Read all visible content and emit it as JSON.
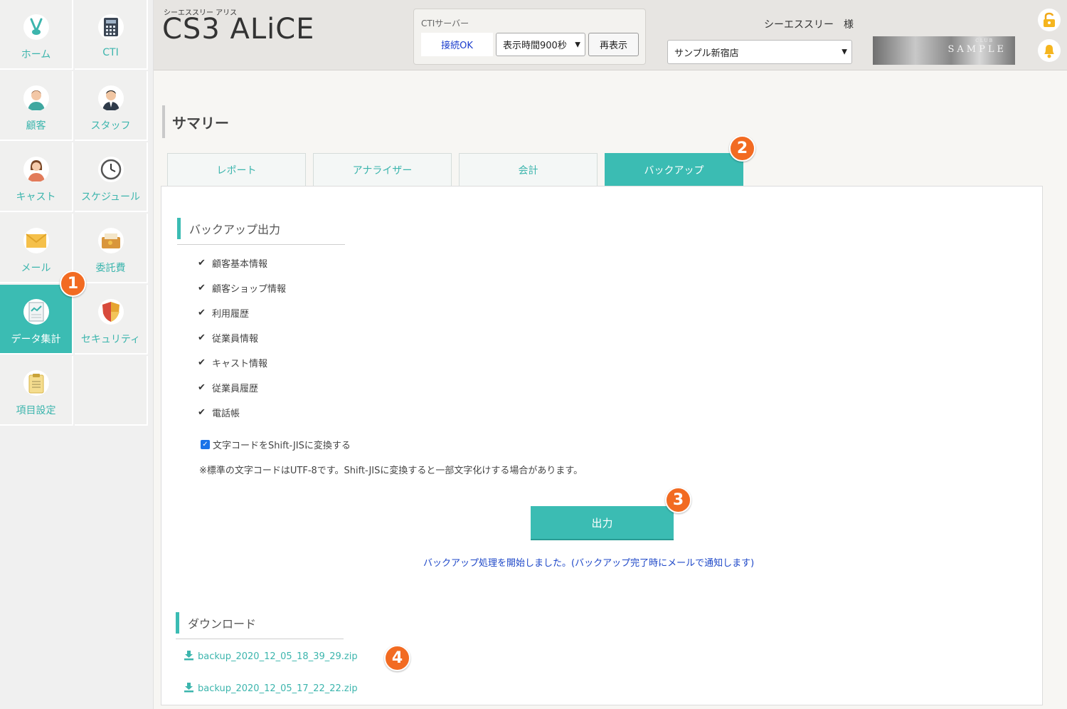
{
  "sidebar": {
    "items": [
      {
        "key": "home",
        "label": "ホーム",
        "icon": "rabbit-icon"
      },
      {
        "key": "cti",
        "label": "CTI",
        "icon": "phone-icon"
      },
      {
        "key": "customer",
        "label": "顧客",
        "icon": "customer-avatar-icon"
      },
      {
        "key": "staff",
        "label": "スタッフ",
        "icon": "staff-avatar-icon"
      },
      {
        "key": "cast",
        "label": "キャスト",
        "icon": "cast-avatar-icon"
      },
      {
        "key": "schedule",
        "label": "スケジュール",
        "icon": "clock-icon"
      },
      {
        "key": "mail",
        "label": "メール",
        "icon": "envelope-icon"
      },
      {
        "key": "commission",
        "label": "委託費",
        "icon": "wallet-icon"
      },
      {
        "key": "data",
        "label": "データ集計",
        "icon": "report-icon"
      },
      {
        "key": "security",
        "label": "セキュリティ",
        "icon": "shield-icon"
      },
      {
        "key": "settings",
        "label": "項目設定",
        "icon": "clipboard-icon"
      }
    ],
    "active": "データ集計"
  },
  "header": {
    "brand_sub": "シーエススリー アリス",
    "brand": "CS3 ALiCE",
    "cti_title": "CTIサーバー",
    "cti_status": "接続OK",
    "cti_display_time": "表示時間900秒",
    "refresh_label": "再表示",
    "user_name": "シーエススリー　様",
    "shop": "サンプル新宿店",
    "banner_club": "CLUB",
    "banner_sample": "SAMPLE"
  },
  "page": {
    "title": "サマリー",
    "tabs": [
      "レポート",
      "アナライザー",
      "会計",
      "バックアップ"
    ],
    "active_tab": "バックアップ"
  },
  "backup": {
    "section_title": "バックアップ出力",
    "items": [
      "顧客基本情報",
      "顧客ショップ情報",
      "利用履歴",
      "従業員情報",
      "キャスト情報",
      "従業員履歴",
      "電話帳"
    ],
    "convert_label": "文字コードをShift-JISに変換する",
    "convert_checked": true,
    "note": "※標準の文字コードはUTF-8です。Shift-JISに変換すると一部文字化けする場合があります。",
    "output_label": "出力",
    "status_message": "バックアップ処理を開始しました。(バックアップ完了時にメールで通知します)"
  },
  "download": {
    "section_title": "ダウンロード",
    "files": [
      "backup_2020_12_05_18_39_29.zip",
      "backup_2020_12_05_17_22_22.zip"
    ]
  },
  "badges": [
    "1",
    "2",
    "3",
    "4"
  ],
  "colors": {
    "accent": "#3bbcb3",
    "badge": "#f26b22",
    "link_blue": "#1d47c8"
  }
}
